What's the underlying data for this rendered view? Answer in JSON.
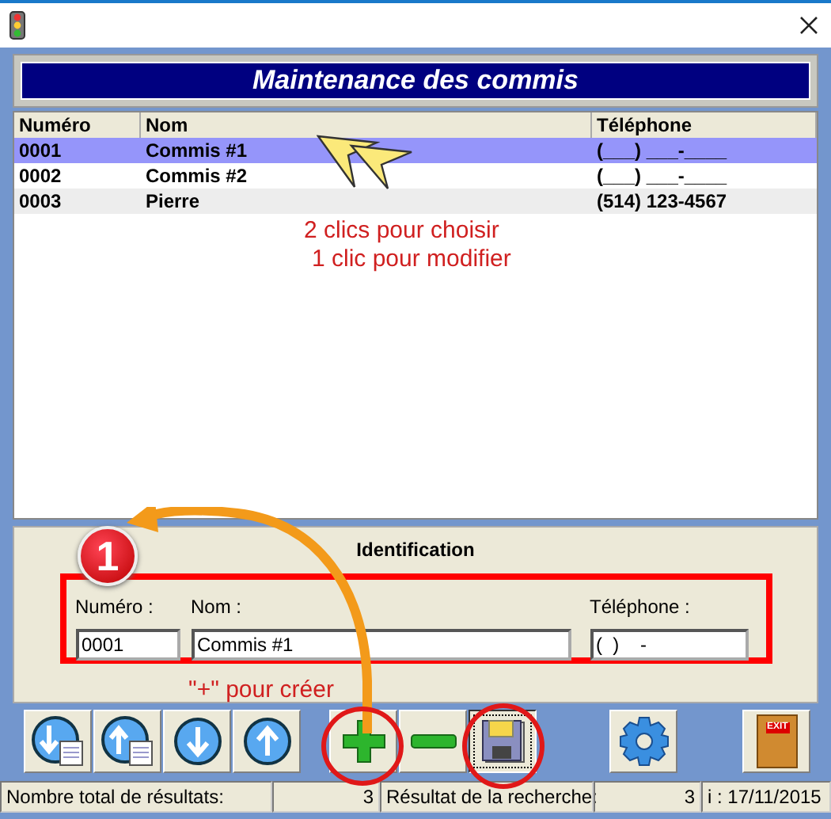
{
  "heading": "Maintenance des commis",
  "table": {
    "columns": [
      "Numéro",
      "Nom",
      "Téléphone"
    ],
    "rows": [
      {
        "cells": [
          "0001",
          "Commis #1",
          "(___) ___-____"
        ],
        "selected": true
      },
      {
        "cells": [
          "0002",
          "Commis #2",
          "(___) ___-____"
        ],
        "selected": false
      },
      {
        "cells": [
          "0003",
          "Pierre",
          "(514) 123-4567"
        ],
        "selected": false
      }
    ]
  },
  "hints": [
    "2 clics pour choisir",
    "1 clic pour modifier"
  ],
  "badge": "1",
  "create_hint": "\"+\" pour créer",
  "panel": {
    "title": "Identification",
    "fields": [
      {
        "label": "Numéro :",
        "value": "0001"
      },
      {
        "label": "Nom :",
        "value": "Commis #1"
      },
      {
        "label": "Téléphone :",
        "value": "(  )    -"
      }
    ]
  },
  "toolbar": [
    {
      "kind": "first",
      "pressed": false
    },
    {
      "kind": "previous-page",
      "pressed": false
    },
    {
      "kind": "down",
      "pressed": false
    },
    {
      "kind": "up",
      "pressed": false
    },
    {
      "kind": "add",
      "pressed": false
    },
    {
      "kind": "remove",
      "pressed": false
    },
    {
      "kind": "save",
      "pressed": true
    },
    {
      "kind": "settings",
      "pressed": false
    },
    {
      "kind": "exit",
      "pressed": false
    }
  ],
  "exit_label": "EXIT",
  "status_bar": [
    {
      "text": "Nombre total de résultats:",
      "kind": "label"
    },
    {
      "text": "3",
      "kind": "count"
    },
    {
      "text": "Résultat de la recherche:",
      "kind": "label"
    },
    {
      "text": "3",
      "kind": "count"
    },
    {
      "text": "i : 17/11/2015",
      "kind": "label"
    }
  ]
}
